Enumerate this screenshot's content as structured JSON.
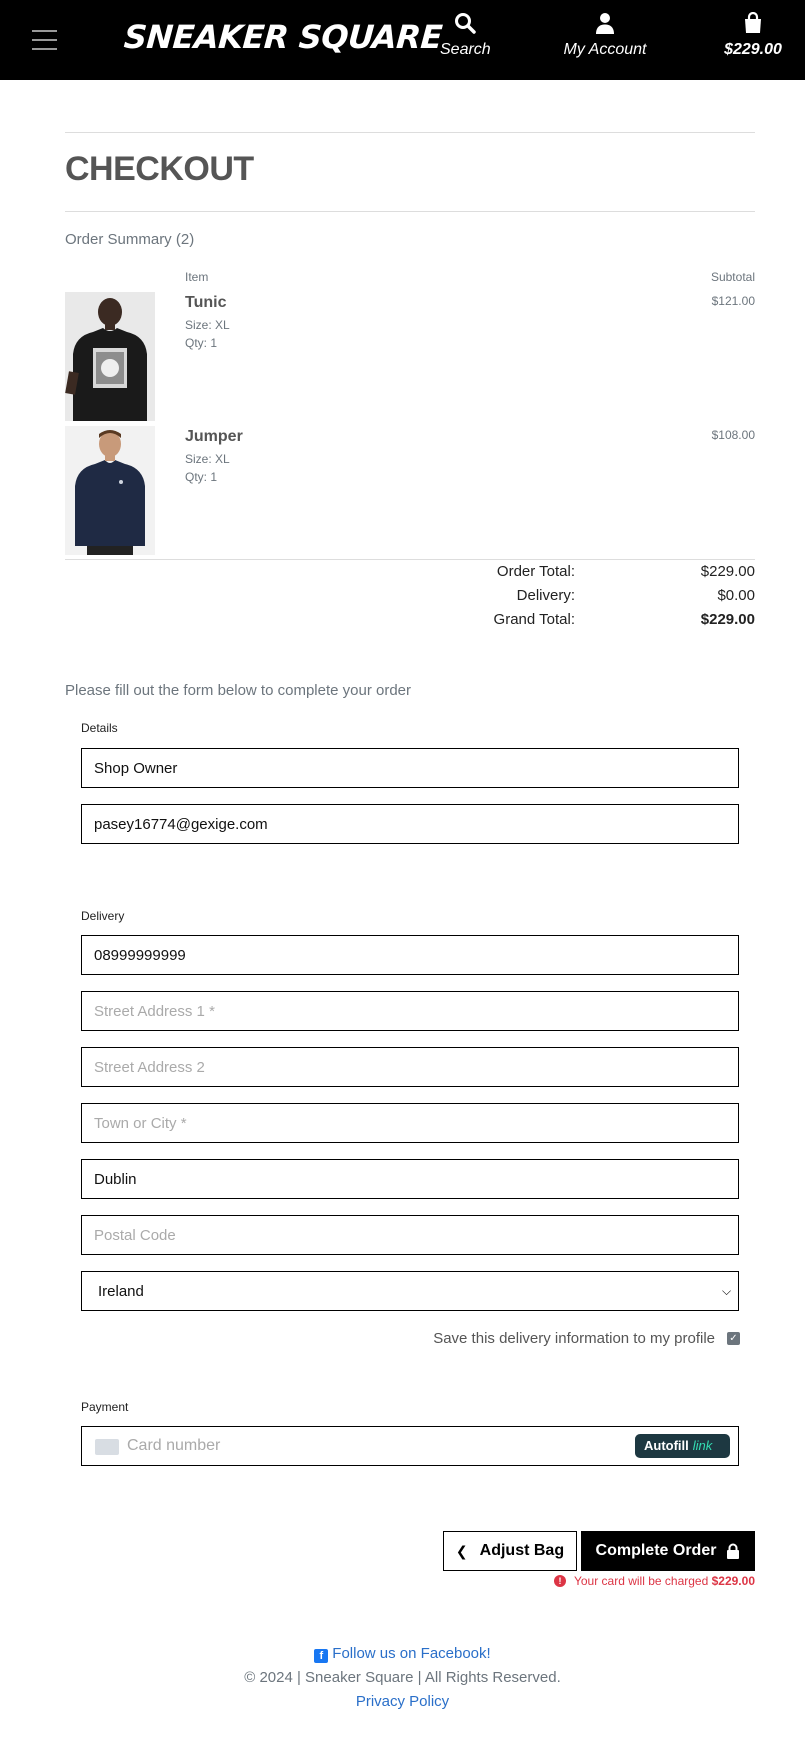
{
  "header": {
    "brand": "SNEAKER SQUARE",
    "search_label": "Search",
    "account_label": "My Account",
    "bag_total": "$229.00"
  },
  "checkout": {
    "title": "CHECKOUT",
    "summary_title": "Order Summary (2)",
    "col_item": "Item",
    "col_subtotal": "Subtotal",
    "items": [
      {
        "name": "Tunic",
        "size": "Size: XL",
        "qty": "Qty: 1",
        "subtotal": "$121.00"
      },
      {
        "name": "Jumper",
        "size": "Size: XL",
        "qty": "Qty: 1",
        "subtotal": "$108.00"
      }
    ],
    "totals": {
      "order_total_label": "Order Total:",
      "order_total": "$229.00",
      "delivery_label": "Delivery:",
      "delivery": "$0.00",
      "grand_total_label": "Grand Total:",
      "grand_total": "$229.00"
    }
  },
  "form": {
    "intro": "Please fill out the form below to complete your order",
    "details_label": "Details",
    "full_name": "Shop Owner",
    "email": "pasey16774@gexige.com",
    "delivery_label": "Delivery",
    "phone": "08999999999",
    "street1_placeholder": "Street Address 1 *",
    "street2_placeholder": "Street Address 2",
    "town_placeholder": "Town or City *",
    "county": "Dublin",
    "postcode_placeholder": "Postal Code",
    "country": "Ireland",
    "save_info_label": "Save this delivery information to my profile",
    "payment_label": "Payment",
    "card_placeholder": "Card number",
    "autofill_label": "Autofill",
    "autofill_link": "link"
  },
  "actions": {
    "adjust_bag": "Adjust Bag",
    "complete_order": "Complete Order",
    "charge_note": "Your card will be charged",
    "charge_amount": "$229.00"
  },
  "footer": {
    "facebook": "Follow us on Facebook!",
    "copyright": "© 2024 | Sneaker Square | All Rights Reserved.",
    "privacy": "Privacy Policy"
  }
}
